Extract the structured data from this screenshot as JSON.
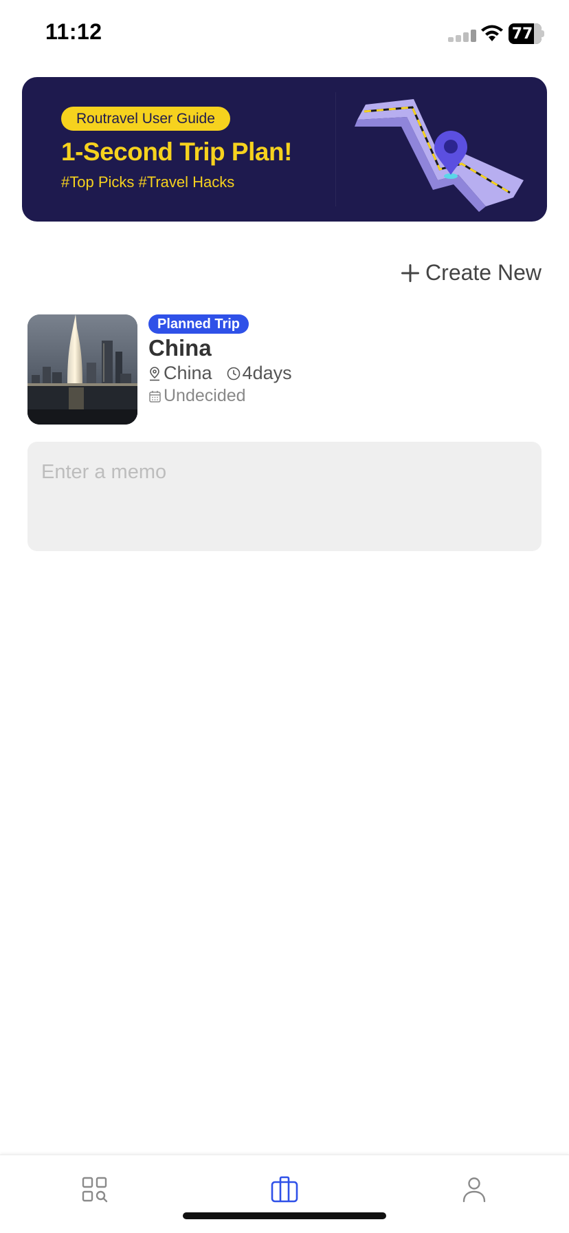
{
  "status_bar": {
    "time": "11:12",
    "battery": "77",
    "icons": [
      "signal-icon",
      "wifi-icon",
      "battery-icon"
    ]
  },
  "banner": {
    "pill": "Routravel User Guide",
    "title": "1-Second Trip Plan!",
    "tags": "#Top Picks #Travel Hacks",
    "colors": {
      "background": "#1e1a4e",
      "accent": "#f6d21e"
    }
  },
  "actions": {
    "create_new": "Create New"
  },
  "trip": {
    "badge": "Planned Trip",
    "title": "China",
    "location": "China",
    "duration": "4days",
    "date": "Undecided",
    "badge_color": "#2f51e8"
  },
  "memo": {
    "placeholder": "Enter a memo",
    "value": ""
  },
  "bottom_nav": {
    "items": [
      {
        "icon": "explore-grid-icon",
        "active": false
      },
      {
        "icon": "suitcase-icon",
        "active": true
      },
      {
        "icon": "profile-icon",
        "active": false
      }
    ],
    "active_color": "#2f51e8",
    "inactive_color": "#8a8a8a"
  }
}
